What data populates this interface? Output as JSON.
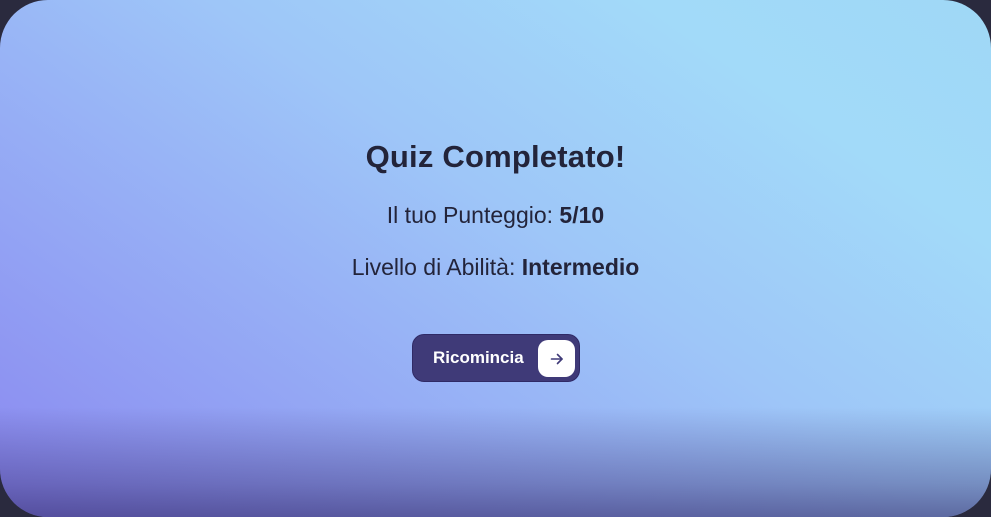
{
  "result": {
    "title": "Quiz Completato!",
    "score_label": "Il tuo Punteggio:",
    "score_value": "5/10",
    "level_label": "Livello di Abilità:",
    "level_value": "Intermedio"
  },
  "restart_button": {
    "label": "Ricomincia",
    "icon": "arrow-right-icon"
  },
  "colors": {
    "accent": "#3f3a78",
    "text": "#23243a",
    "gradient_start": "#8a87f0",
    "gradient_end": "#a2daf9"
  }
}
